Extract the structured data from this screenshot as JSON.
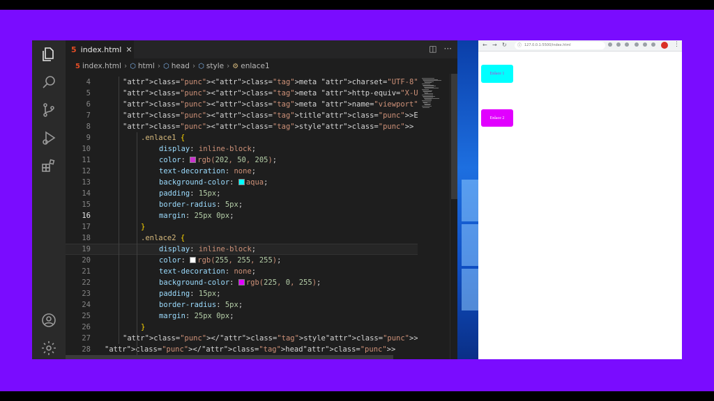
{
  "editor": {
    "tab_label": "index.html",
    "tab_close": "✕",
    "breadcrumb": [
      "index.html",
      "html",
      "head",
      "style",
      "enlace1"
    ],
    "current_line": 16,
    "lines": [
      {
        "n": "4",
        "text": "<meta charset=\"UTF-8\">"
      },
      {
        "n": "5",
        "text": "<meta http-equiv=\"X-UA-Compatible\" content=\"IE=edge\">"
      },
      {
        "n": "6",
        "text": "<meta name=\"viewport\" content=\"width=device-width, initial-scale="
      },
      {
        "n": "7",
        "text": "<title>Enlaces</title>"
      },
      {
        "n": "8",
        "text": "<style>"
      },
      {
        "n": "9",
        "text": ".enlace1 {"
      },
      {
        "n": "10",
        "text": "display: inline-block;"
      },
      {
        "n": "11",
        "text": "color: rgb(202, 50, 205);"
      },
      {
        "n": "12",
        "text": "text-decoration: none;"
      },
      {
        "n": "13",
        "text": "background-color: aqua;"
      },
      {
        "n": "14",
        "text": "padding: 15px;"
      },
      {
        "n": "15",
        "text": "border-radius: 5px;"
      },
      {
        "n": "16",
        "text": "margin: 25px 0px;"
      },
      {
        "n": "17",
        "text": "}"
      },
      {
        "n": "18",
        "text": ".enlace2 {"
      },
      {
        "n": "19",
        "text": "display: inline-block;"
      },
      {
        "n": "20",
        "text": "color: rgb(255, 255, 255);"
      },
      {
        "n": "21",
        "text": "text-decoration: none;"
      },
      {
        "n": "22",
        "text": "background-color: rgb(225, 0, 255);"
      },
      {
        "n": "23",
        "text": "padding: 15px;"
      },
      {
        "n": "24",
        "text": "border-radius: 5px;"
      },
      {
        "n": "25",
        "text": "margin: 25px 0px;"
      },
      {
        "n": "26",
        "text": "}"
      },
      {
        "n": "27",
        "text": "</style>"
      },
      {
        "n": "28",
        "text": "</head>"
      }
    ]
  },
  "activity_bar": [
    "explorer-icon",
    "search-icon",
    "source-control-icon",
    "run-debug-icon",
    "extensions-icon",
    "accounts-icon",
    "settings-gear-icon"
  ],
  "browser": {
    "url": "127.0.0.1:5500/index.html",
    "enlace1_text": "Enlace 1",
    "enlace2_text": "Enlace 2"
  },
  "colors": {
    "frame": "#7a0cff",
    "swatch_enlace1_color": "rgb(202, 50, 205)",
    "swatch_aqua": "aqua",
    "swatch_white": "rgb(255, 255, 255)",
    "swatch_magenta": "rgb(225, 0, 255)"
  }
}
